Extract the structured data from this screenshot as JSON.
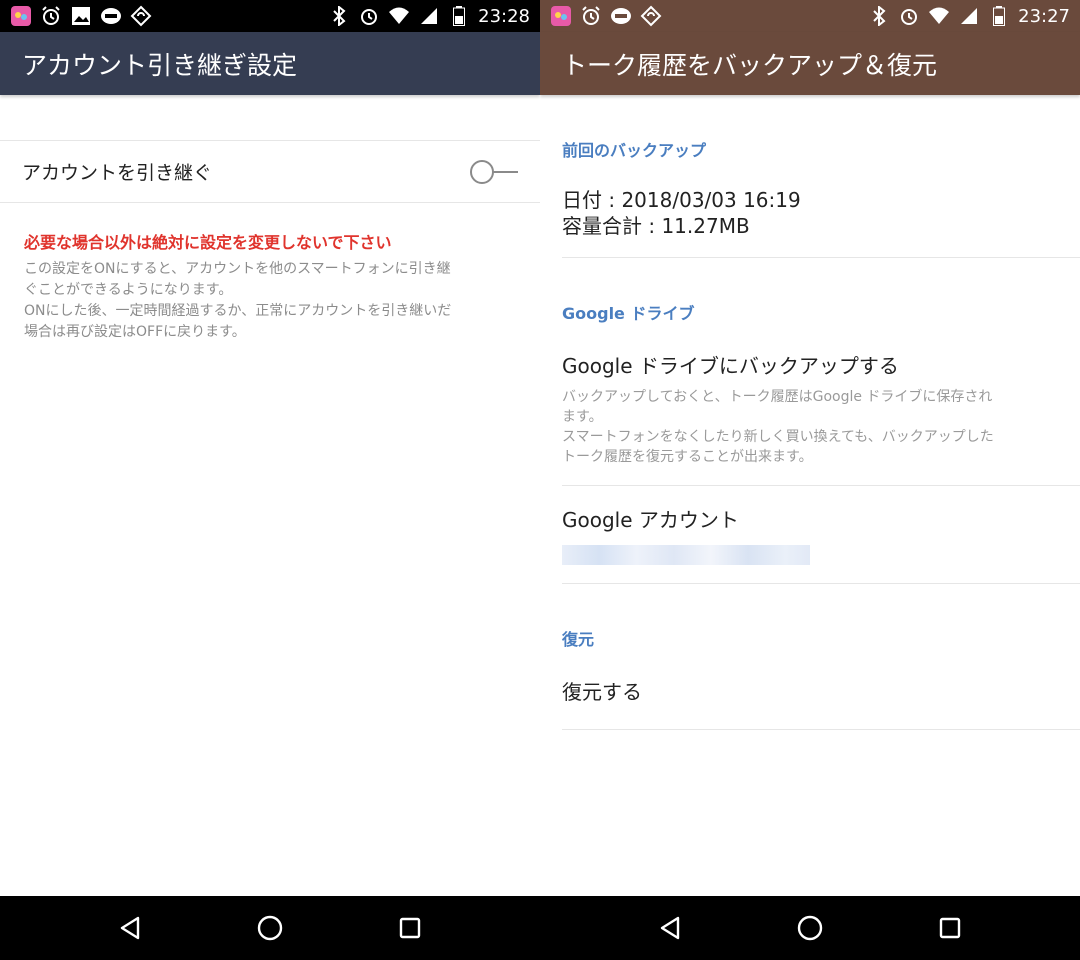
{
  "left": {
    "status": {
      "time": "23:28"
    },
    "title": "アカウント引き継ぎ設定",
    "toggle": {
      "label": "アカウントを引き継ぐ",
      "on": false
    },
    "warning": "必要な場合以外は絶対に設定を変更しないで下さい",
    "description_lines": [
      "この設定をONにすると、アカウントを他のスマートフォンに引き継",
      "ぐことができるようになります。",
      "ONにした後、一定時間経過するか、正常にアカウントを引き継いだ",
      "場合は再び設定はOFFに戻ります。"
    ]
  },
  "right": {
    "status": {
      "time": "23:27"
    },
    "title": "トーク履歴をバックアップ＆復元",
    "last_backup": {
      "header": "前回のバックアップ",
      "date": "日付 : 2018/03/03 16:19",
      "size": "容量合計 : 11.27MB"
    },
    "google_drive": {
      "header": "Google ドライブ",
      "backup_title": "Google ドライブにバックアップする",
      "backup_desc_lines": [
        "バックアップしておくと、トーク履歴はGoogle ドライブに保存され",
        "ます。",
        "スマートフォンをなくしたり新しく買い換えても、バックアップした",
        "トーク履歴を復元することが出来ます。"
      ],
      "account_title": "Google アカウント"
    },
    "restore": {
      "header": "復元",
      "action": "復元する"
    }
  },
  "colors": {
    "left_appbar": "#353d52",
    "right_appbar": "#6a4a3c",
    "warning": "#e0342d",
    "section_header": "#4a7ec0"
  },
  "icons": {
    "status_left": [
      "app-notification-icon",
      "alarm-clock-icon",
      "image-icon",
      "line-app-icon",
      "sync-icon"
    ],
    "status_right": [
      "bluetooth-icon",
      "alarm-icon",
      "wifi-icon",
      "signal-icon",
      "battery-icon"
    ],
    "nav": [
      "back-icon",
      "home-icon",
      "recents-icon"
    ]
  }
}
